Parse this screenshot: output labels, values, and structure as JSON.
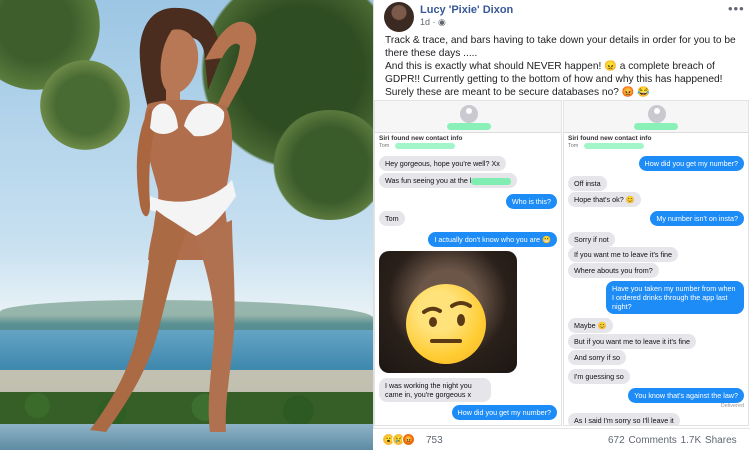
{
  "post": {
    "author": "Lucy 'Pixie' Dixon",
    "time": "1d",
    "time_separator": " · ",
    "more_icon": "more-options-icon",
    "caption_line1": "Track & trace, and bars having to take down your details in order for you to be there these days .....",
    "caption_line2_prefix": "And this is exactly what should NEVER happen!",
    "caption_line2_mid": "a complete breach of GDPR!! Currently getting to the bottom of how and why this has happened! Surely these are meant to be secure databases no?",
    "reaction_count": "753",
    "comments": "672 Comments",
    "shares": "1.7K Shares"
  },
  "left_chat": {
    "siri_title": "Siri found new contact info",
    "siri_sub": "Tom",
    "messages": [
      {
        "text": "Hey gorgeous, hope you're well? Xx",
        "side": "in"
      },
      {
        "text": "Was fun seeing you at the l",
        "side": "in"
      },
      {
        "text": "Who is this?",
        "side": "out"
      },
      {
        "text": "Tom",
        "side": "in"
      },
      {
        "text": "I actually don't know who you are",
        "side": "out"
      },
      {
        "text": "I was working the night you came in, you're gorgeous x",
        "side": "in"
      },
      {
        "text": "How did you get my number?",
        "side": "out"
      }
    ]
  },
  "right_chat": {
    "siri_title": "Siri found new contact info",
    "siri_sub": "Tom",
    "messages": [
      {
        "text": "How did you get my number?",
        "side": "out"
      },
      {
        "text": "Off insta",
        "side": "in"
      },
      {
        "text": "Hope that's ok?",
        "side": "in"
      },
      {
        "text": "My number isn't on insta?",
        "side": "out"
      },
      {
        "text": "Sorry if not",
        "side": "in"
      },
      {
        "text": "If you want me to leave it's fine",
        "side": "in"
      },
      {
        "text": "Where abouts you from?",
        "side": "in"
      },
      {
        "text": "Have you taken my number from when I ordered drinks through the app last night?",
        "side": "out"
      },
      {
        "text": "Maybe",
        "side": "in"
      },
      {
        "text": "But if you want me to leave it it's fine",
        "side": "in"
      },
      {
        "text": "And sorry if so",
        "side": "in"
      },
      {
        "text": "I'm guessing so",
        "side": "in"
      },
      {
        "text": "You know that's against the law?",
        "side": "out"
      },
      {
        "text": "As I said I'm sorry so I'll leave it",
        "side": "in"
      }
    ],
    "delivered": "Delivered"
  },
  "colors": {
    "link_blue": "#385898",
    "imessage_blue": "#1e8cf7",
    "bubble_gray": "#e5e5ea",
    "redaction_green": "#6ef0a8"
  }
}
